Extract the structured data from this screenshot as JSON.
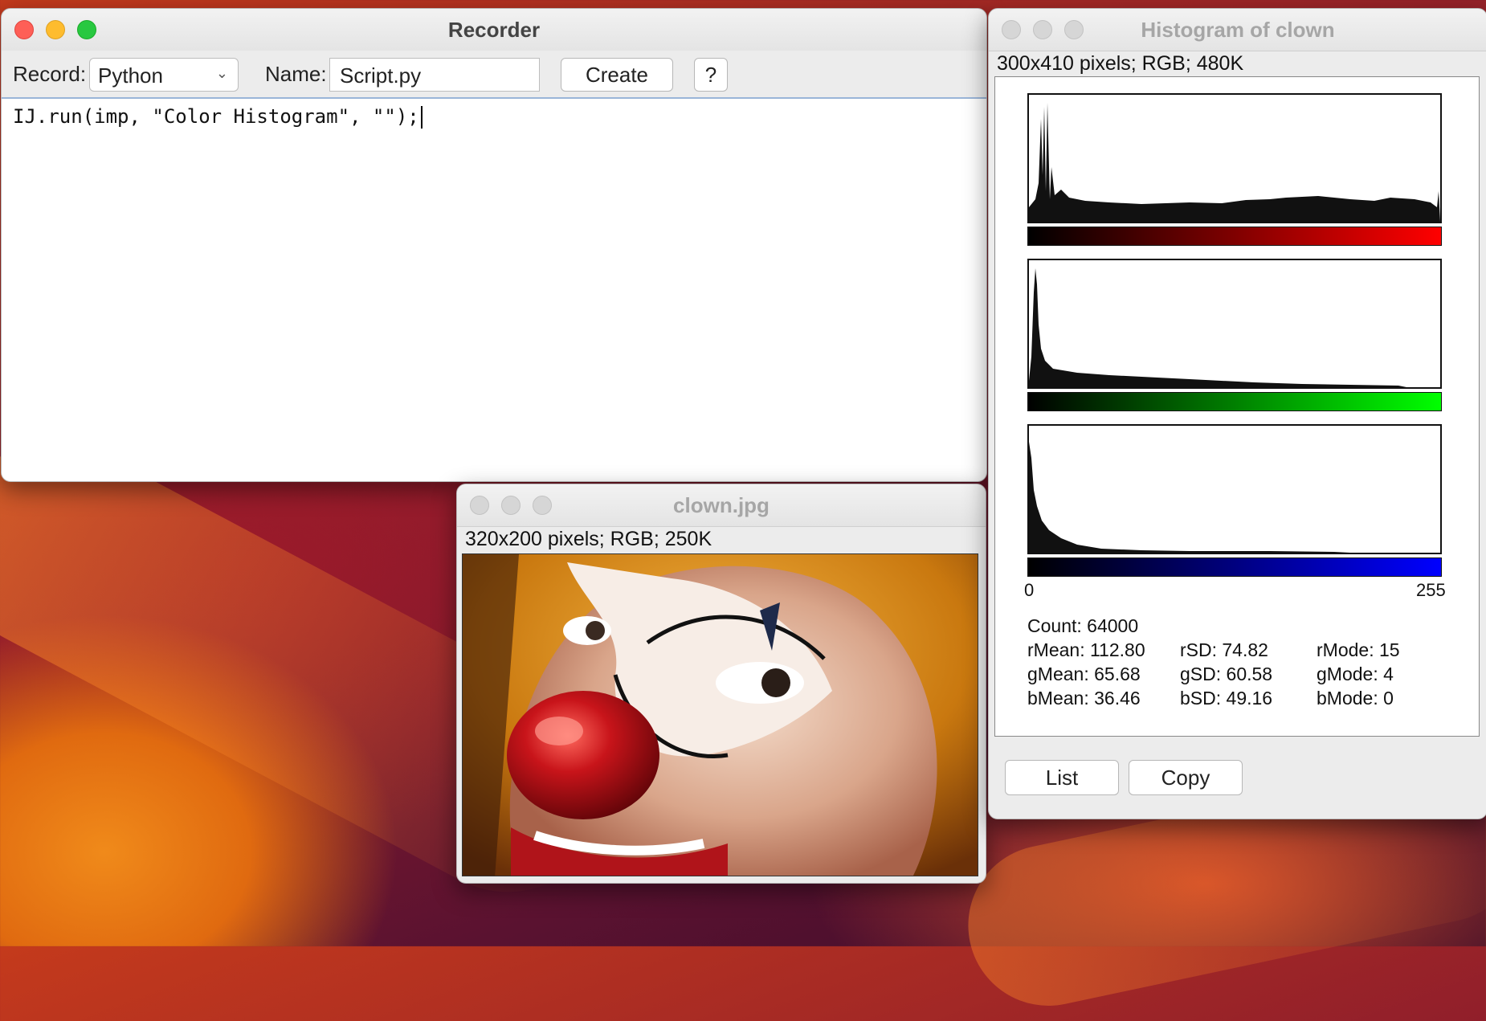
{
  "recorder": {
    "title": "Recorder",
    "record_label": "Record:",
    "record_value": "Python",
    "name_label": "Name:",
    "name_value": "Script.py",
    "create_label": "Create",
    "help_label": "?",
    "code": "IJ.run(imp, \"Color Histogram\", \"\");"
  },
  "image_window": {
    "title": "clown.jpg",
    "info": "320x200 pixels; RGB; 250K"
  },
  "histogram_window": {
    "title": "Histogram of clown",
    "info": "300x410 pixels; RGB; 480K",
    "axis_min": "0",
    "axis_max": "255",
    "channel_colors": {
      "red": "#ff0000",
      "green": "#00ff00",
      "blue": "#0000ff"
    },
    "stats": {
      "count": "Count: 64000",
      "r_mean": "rMean: 112.80",
      "r_sd": "rSD: 74.82",
      "r_mode": "rMode: 15",
      "g_mean": "gMean: 65.68",
      "g_sd": "gSD: 60.58",
      "g_mode": "gMode: 4",
      "b_mean": "bMean: 36.46",
      "b_sd": "bSD: 49.16",
      "b_mode": "bMode: 0"
    },
    "list_label": "List",
    "copy_label": "Copy"
  }
}
